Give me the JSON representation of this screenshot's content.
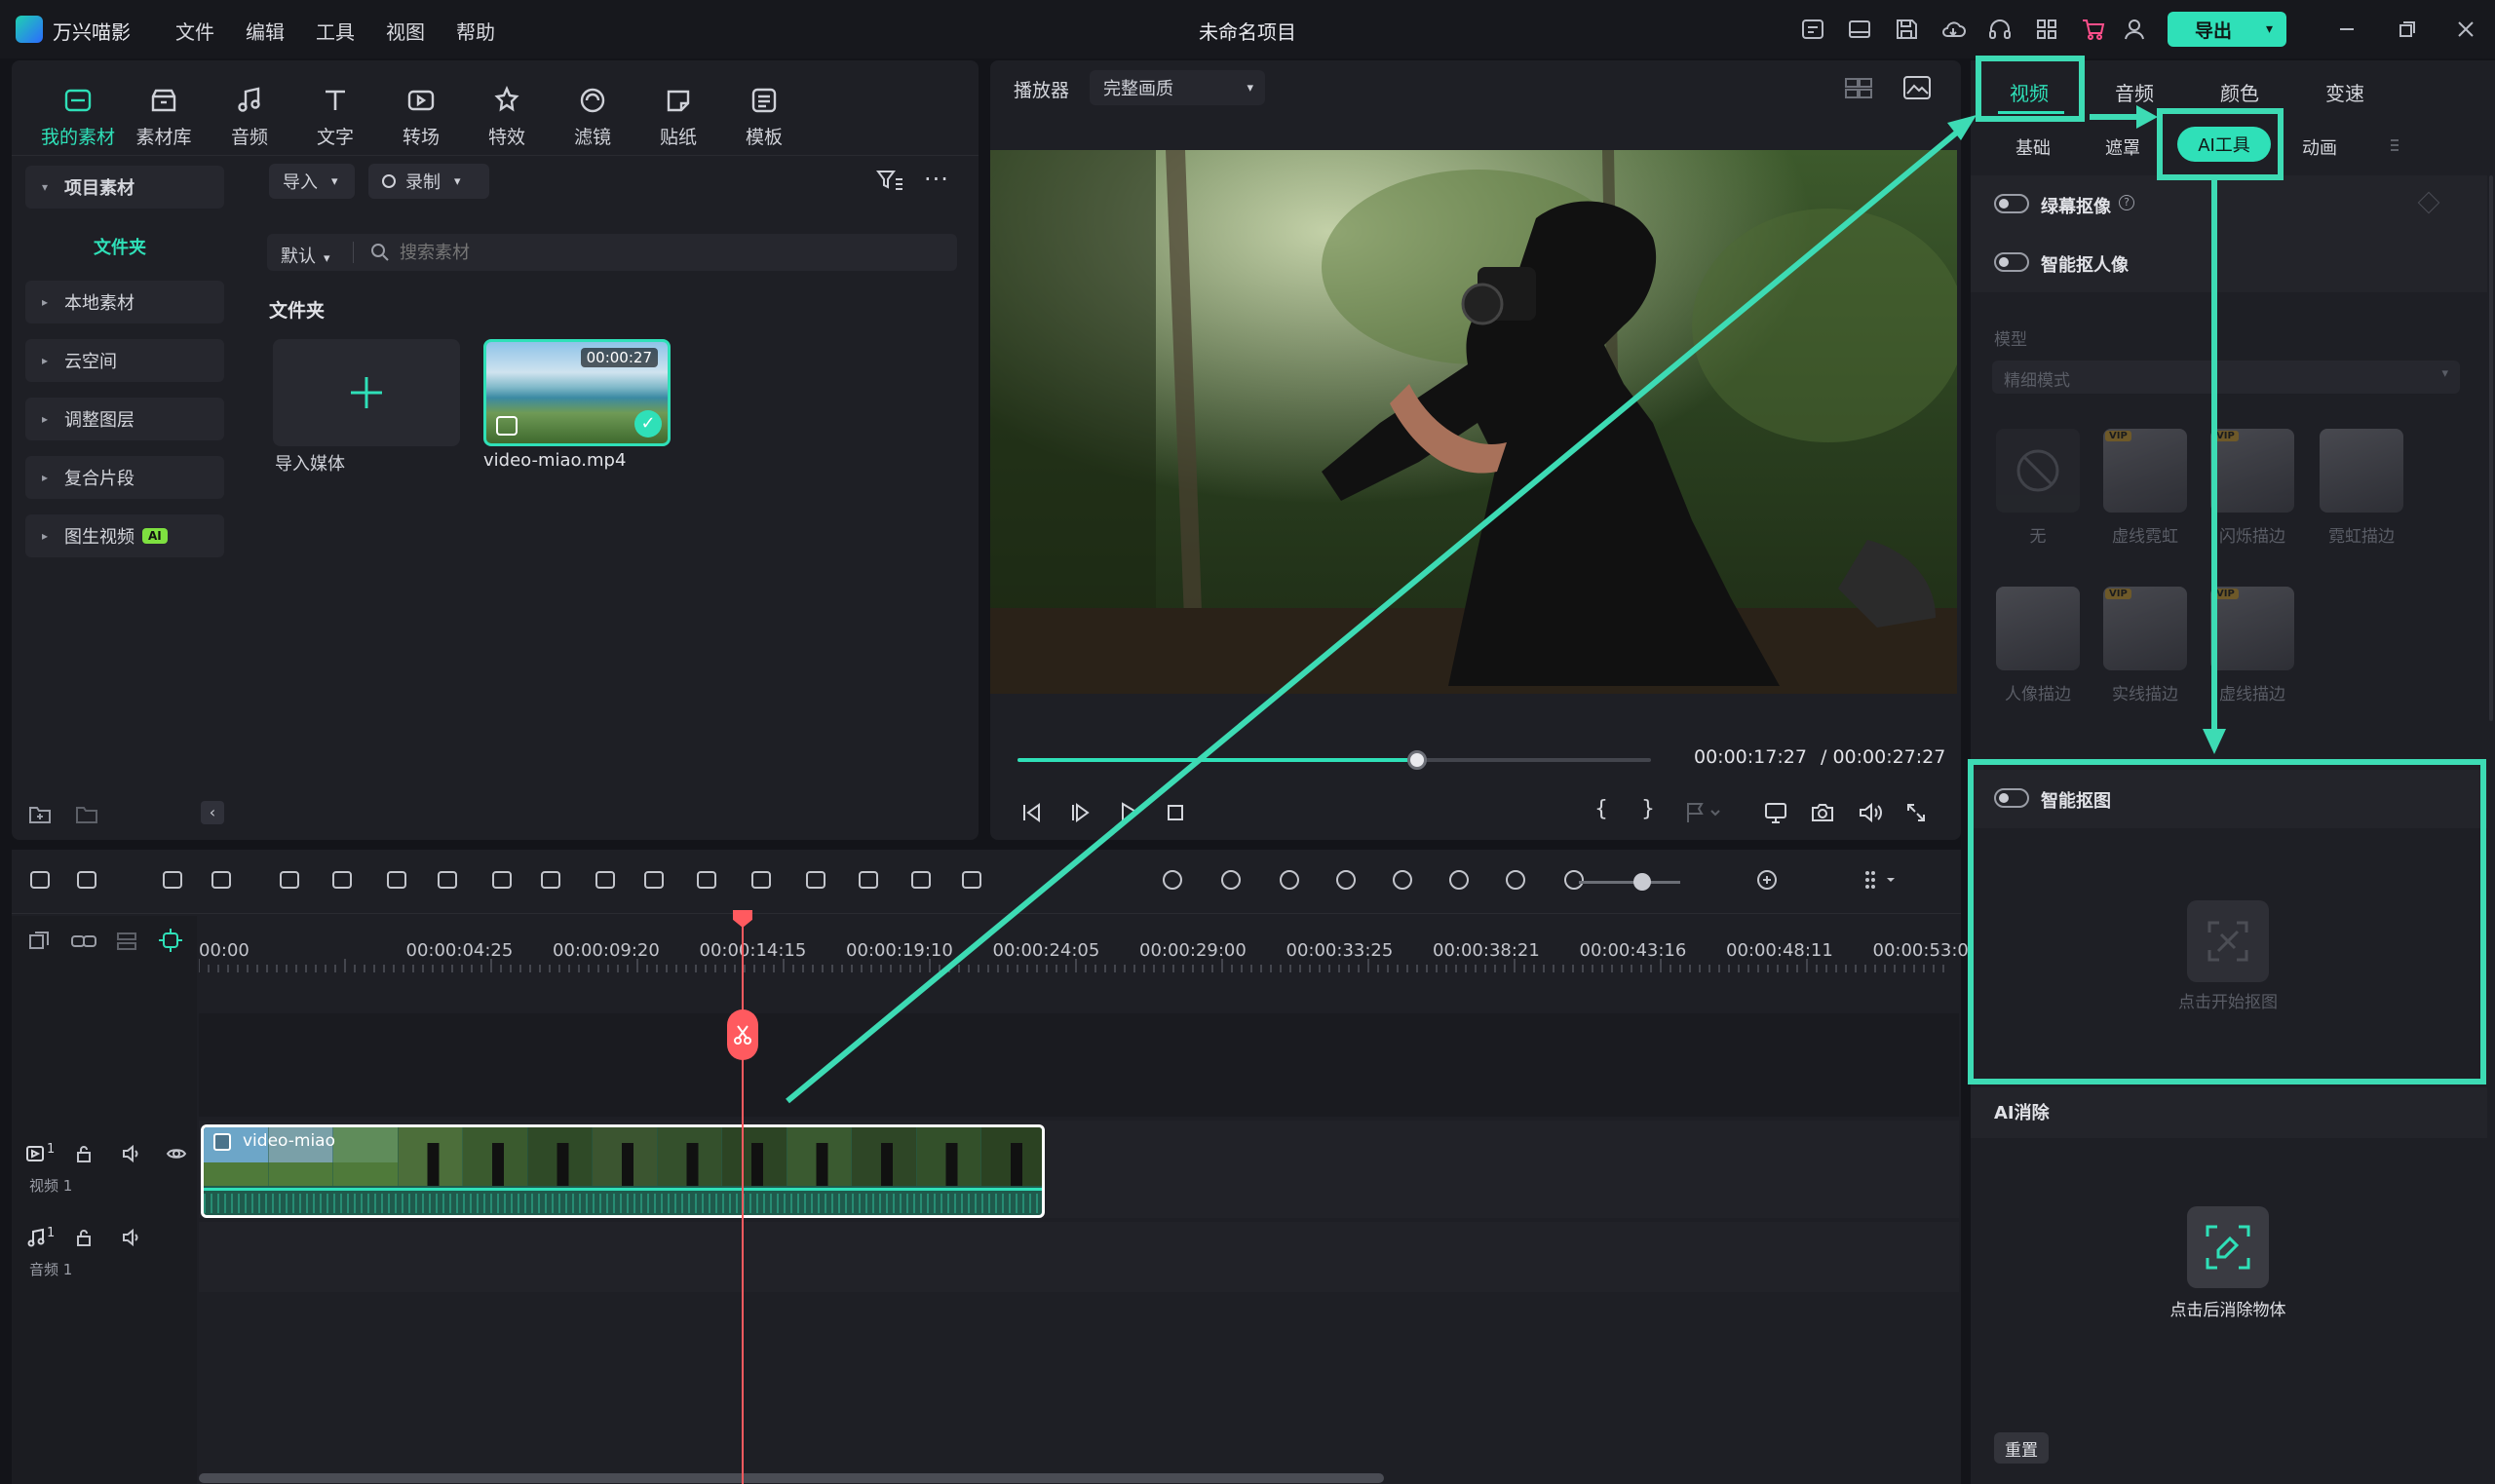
{
  "app": {
    "name": "万兴喵影",
    "project_title": "未命名项目",
    "export_label": "导出"
  },
  "menu": [
    "文件",
    "编辑",
    "工具",
    "视图",
    "帮助"
  ],
  "toolbar_tabs": [
    "我的素材",
    "素材库",
    "音频",
    "文字",
    "转场",
    "特效",
    "滤镜",
    "贴纸",
    "模板"
  ],
  "sidebar": {
    "project_header": "项目素材",
    "folder_item": "文件夹",
    "items": [
      "本地素材",
      "云空间",
      "调整图层",
      "复合片段",
      "图生视频"
    ],
    "ai_badge": "AI"
  },
  "media": {
    "import_label": "导入",
    "record_label": "录制",
    "sort_label": "默认",
    "search_placeholder": "搜索素材",
    "section_title": "文件夹",
    "import_tile_label": "导入媒体",
    "clip_name": "video-miao.mp4",
    "clip_duration": "00:00:27"
  },
  "player": {
    "label": "播放器",
    "quality": "完整画质",
    "current_time": "00:00:17:27",
    "total_time": "/ 00:00:27:27",
    "progress": 0.63
  },
  "timeline": {
    "ticks": [
      "00:00",
      "00:00:04:25",
      "00:00:09:20",
      "00:00:14:15",
      "00:00:19:10",
      "00:00:24:05",
      "00:00:29:00",
      "00:00:33:25",
      "00:00:38:21",
      "00:00:43:16",
      "00:00:48:11",
      "00:00:53:06"
    ],
    "video_track_label": "视频 1",
    "audio_track_label": "音频 1",
    "track_num": "1",
    "clip_title": "video-miao"
  },
  "props": {
    "main_tabs": [
      "视频",
      "音频",
      "颜色",
      "变速"
    ],
    "sub_tabs": [
      "基础",
      "遮罩",
      "AI工具",
      "动画"
    ],
    "green_screen": "绿幕抠像",
    "smart_portrait": "智能抠人像",
    "model_label": "模型",
    "model_value": "精细模式",
    "effects": [
      "无",
      "虚线霓虹",
      "闪烁描边",
      "霓虹描边",
      "人像描边",
      "实线描边",
      "虚线描边"
    ],
    "vip_badge": "VIP",
    "smart_cutout": "智能抠图",
    "cutout_hint": "点击开始抠图",
    "ai_erase": "AI消除",
    "erase_hint": "点击后消除物体",
    "reset": "重置"
  },
  "colors": {
    "accent": "#2fe0b8",
    "playhead": "#ff5a5f",
    "annotation": "#3ddbb4"
  }
}
